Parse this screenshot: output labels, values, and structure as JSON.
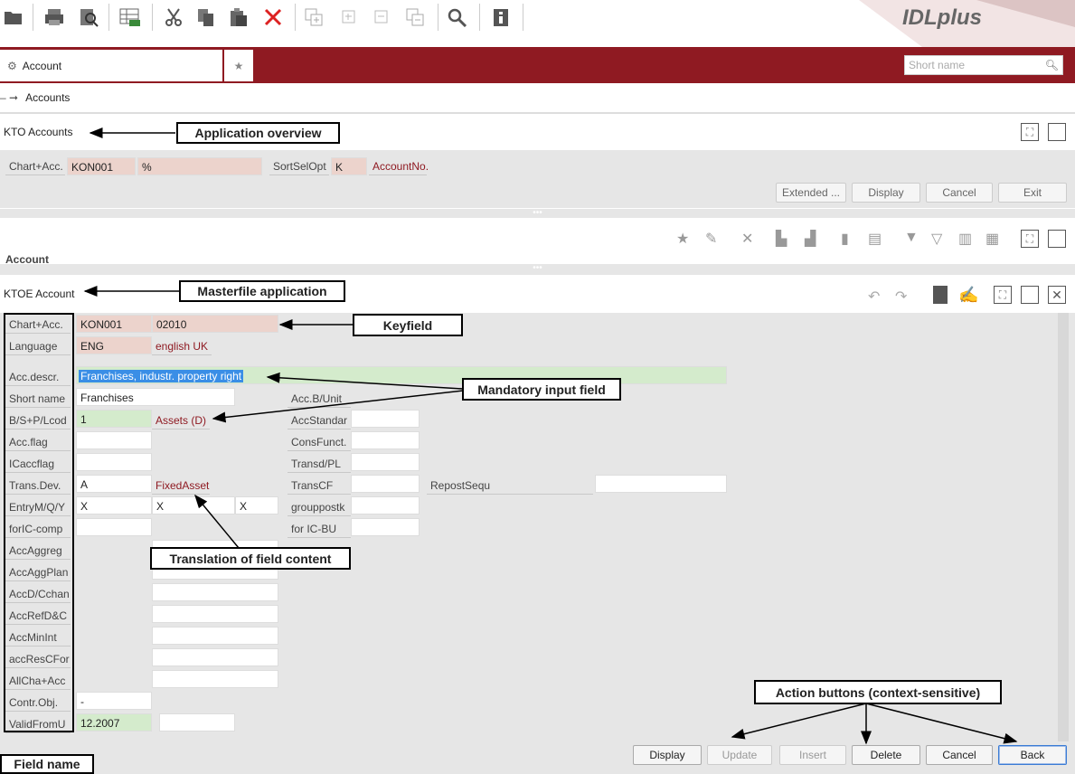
{
  "toolbar": {
    "icons": [
      "open-folder-icon",
      "print-icon",
      "print-preview-icon",
      "export-excel-icon",
      "cut-icon",
      "copy-icon",
      "paste-icon",
      "delete-icon",
      "expand-all-icon",
      "expand-icon",
      "collapse-icon",
      "collapse-all-icon",
      "search-icon",
      "info-icon"
    ]
  },
  "brand": {
    "logo_text": "IDLplus"
  },
  "tab": {
    "label": "Account"
  },
  "search": {
    "placeholder": "Short name"
  },
  "breadcrumb": {
    "label": "Accounts"
  },
  "overview": {
    "title": "KTO Accounts",
    "fields": {
      "chart_label": "Chart+Acc.",
      "chart_value": "KON001",
      "account_value": "%",
      "sortsel_label": "SortSelOpt",
      "sortsel_value": "K",
      "sortsel_translation": "AccountNo."
    },
    "buttons": {
      "extended": "Extended ...",
      "display": "Display",
      "cancel": "Cancel",
      "exit": "Exit"
    },
    "list_header": {
      "account": "Account"
    }
  },
  "master": {
    "title": "KTOE Account",
    "fields": {
      "chart_label": "Chart+Acc.",
      "chart_value": "KON001",
      "account_value": "02010",
      "language_label": "Language",
      "language_value": "ENG",
      "language_translation": "english UK",
      "accdescr_label": "Acc.descr.",
      "accdescr_value": "Franchises, industr. property right",
      "shortname_label": "Short name",
      "shortname_value": "Franchises",
      "bsp_label": "B/S+P/Lcod",
      "bsp_value": "1",
      "bsp_translation": "Assets (D)",
      "accflag_label": "Acc.flag",
      "icaccflag_label": "ICaccflag",
      "transdev_label": "Trans.Dev.",
      "transdev_value": "A",
      "transdev_translation": "FixedAsset",
      "entry_label": "EntryM/Q/Y",
      "entry_m": "X",
      "entry_q": "X",
      "entry_y": "X",
      "foric_label": "forIC-comp",
      "accaggreg_label": "AccAggreg",
      "accaggplan_label": "AccAggPlan",
      "accdc_label": "AccD/Cchan",
      "accref_label": "AccRefD&C",
      "accmin_label": "AccMinInt",
      "accres_label": "accResCFor",
      "allcha_label": "AllCha+Acc",
      "contr_label": "Contr.Obj.",
      "contr_value": "-",
      "valid_label": "ValidFromU",
      "valid_value": "12.2007",
      "accbunit_label": "Acc.B/Unit",
      "accstandar_label": "AccStandar",
      "consfunct_label": "ConsFunct.",
      "transdpl_label": "Transd/PL",
      "transcf_label": "TransCF",
      "grouppostk_label": "grouppostk",
      "foricbu_label": "for IC-BU",
      "repost_label": "RepostSequ"
    },
    "buttons": {
      "display": "Display",
      "update": "Update",
      "insert": "Insert",
      "delete": "Delete",
      "cancel": "Cancel",
      "back": "Back"
    }
  },
  "callouts": {
    "app_overview": "Application overview",
    "masterfile": "Masterfile application",
    "keyfield": "Keyfield",
    "mandatory": "Mandatory input field",
    "translation": "Translation of field content",
    "action_buttons": "Action buttons (context-sensitive)",
    "field_name": "Field name"
  }
}
